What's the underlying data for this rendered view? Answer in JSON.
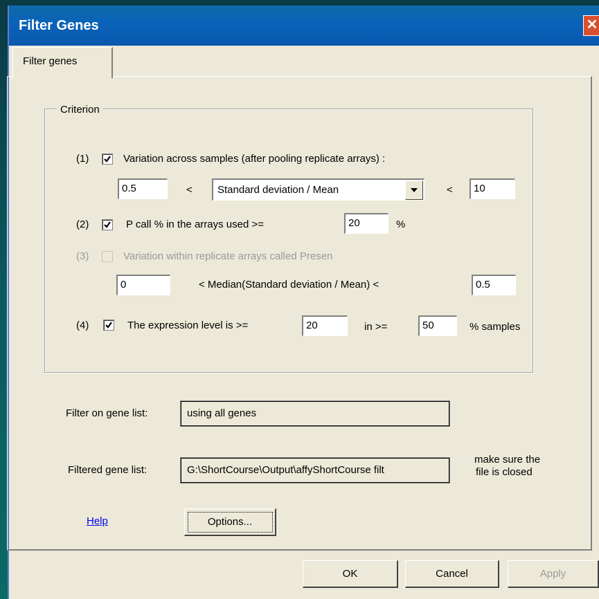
{
  "window": {
    "title": "Filter Genes",
    "close_glyph": "✕"
  },
  "tab": {
    "label": "Filter genes"
  },
  "criterion": {
    "legend": "Criterion",
    "c1": {
      "num": "(1)",
      "checked": true,
      "label": "Variation across samples (after pooling replicate arrays) :",
      "low": "0.5",
      "lt1": "<",
      "measure": "Standard deviation / Mean",
      "lt2": "<",
      "high": "10"
    },
    "c2": {
      "num": "(2)",
      "checked": true,
      "label": "P call % in the arrays used  >=",
      "value": "20",
      "unit": "%"
    },
    "c3": {
      "num": "(3)",
      "checked": false,
      "enabled": false,
      "label": "Variation within replicate arrays called Presen",
      "low": "0",
      "middle": "<  Median(Standard deviation / Mean)  <",
      "high": "0.5"
    },
    "c4": {
      "num": "(4)",
      "checked": true,
      "label": "The expression level is  >=",
      "level": "20",
      "in_label": "in  >=",
      "samples": "50",
      "samples_unit": "% samples"
    }
  },
  "gene_list": {
    "label": "Filter on gene list:",
    "value": "using all genes"
  },
  "filtered": {
    "label": "Filtered gene list:",
    "value": "G:\\ShortCourse\\Output\\affyShortCourse filt",
    "note1": "make sure the",
    "note2": "file is closed"
  },
  "help_link": "Help",
  "options_button": "Options...",
  "buttons": {
    "ok": "OK",
    "cancel": "Cancel",
    "apply": "Apply"
  }
}
